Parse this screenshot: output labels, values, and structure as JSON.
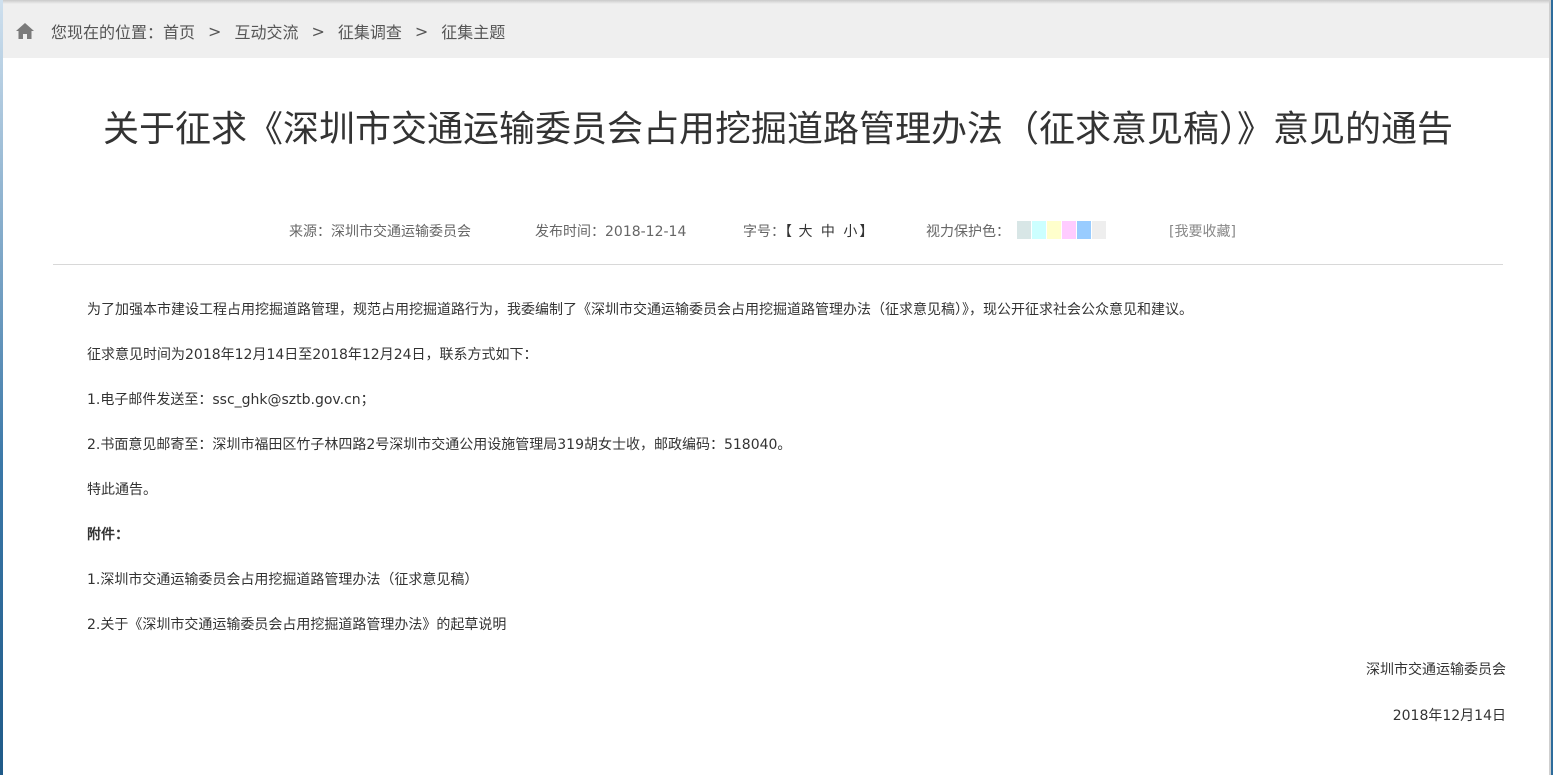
{
  "breadcrumb": {
    "prefix": "您现在的位置：",
    "items": [
      "首页",
      "互动交流",
      "征集调查",
      "征集主题"
    ],
    "separator": ">"
  },
  "article": {
    "title": "关于征求《深圳市交通运输委员会占用挖掘道路管理办法（征求意见稿）》意见的通告",
    "source": "来源：深圳市交通运输委员会",
    "publish": "发布时间：2018-12-14",
    "font_size_label": "字号：",
    "font_sizes": [
      "大",
      "中",
      "小"
    ],
    "bracket_open": "【",
    "bracket_close": "】",
    "eye_care_label": "视力保护色：",
    "eye_care_colors": [
      "#d8e6e6",
      "#ccffff",
      "#ffffcc",
      "#ffccff",
      "#99ccff",
      "#eeeeee"
    ],
    "favorite": "[我要收藏]",
    "paragraphs": [
      "为了加强本市建设工程占用挖掘道路管理，规范占用挖掘道路行为，我委编制了《深圳市交通运输委员会占用挖掘道路管理办法（征求意见稿）》，现公开征求社会公众意见和建议。",
      "征求意见时间为2018年12月14日至2018年12月24日，联系方式如下：",
      "1.电子邮件发送至：ssc_ghk@sztb.gov.cn；",
      "2.书面意见邮寄至：深圳市福田区竹子林四路2号深圳市交通公用设施管理局319胡女士收，邮政编码：518040。",
      "特此通告。"
    ],
    "attachments_label": "附件：",
    "attachments": [
      "1.深圳市交通运输委员会占用挖掘道路管理办法（征求意见稿）",
      "2.关于《深圳市交通运输委员会占用挖掘道路管理办法》的起草说明"
    ],
    "signature": "深圳市交通运输委员会",
    "date": "2018年12月14日"
  }
}
